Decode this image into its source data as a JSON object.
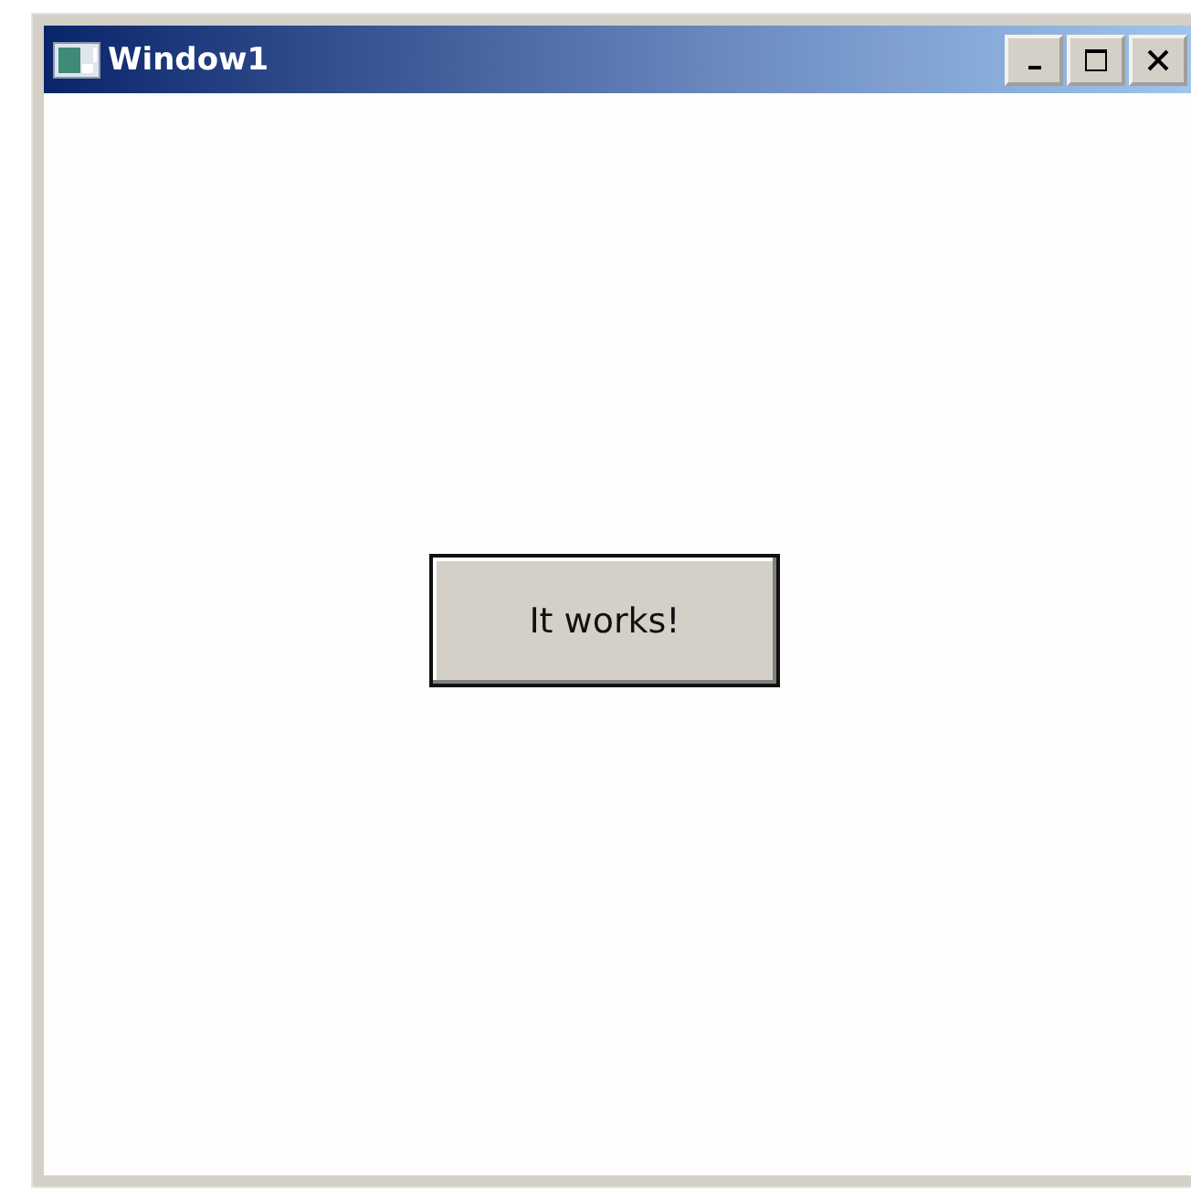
{
  "window": {
    "title": "Window1"
  },
  "button": {
    "label": "It works!"
  }
}
